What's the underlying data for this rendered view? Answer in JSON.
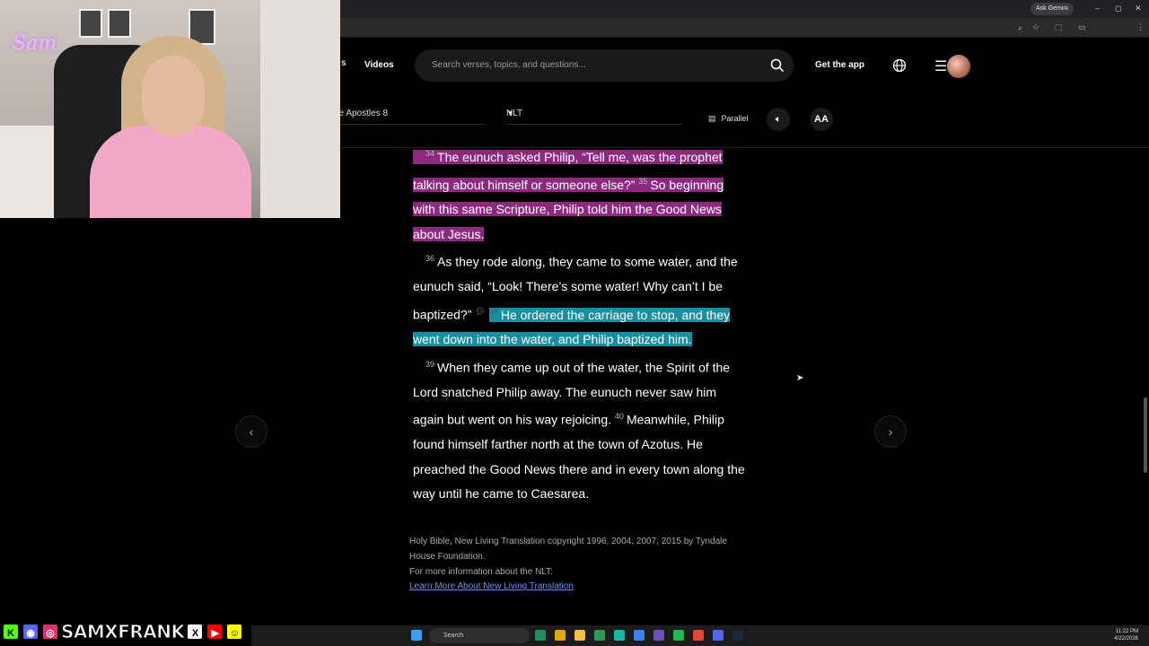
{
  "browser": {
    "gemini_label": "Ask Gemini",
    "window_controls": [
      "–",
      "◻",
      "✕"
    ]
  },
  "header": {
    "nav_partial": "s",
    "nav_videos": "Videos",
    "search_placeholder": "Search verses, topics, and questions...",
    "get_app": "Get the app",
    "book": "he Apostles 8",
    "version": "NLT",
    "parallel": "Parallel",
    "aa": "AA"
  },
  "passage": {
    "v34_num": "34",
    "v34_a": "The eunuch asked Philip, “Tell me, was the prophet talking about himself or someone else?”",
    "v35_num": "35",
    "v35": "So beginning with this same Scripture, Philip told him the Good News about Jesus.",
    "v36_num": "36",
    "v36": "As they rode along, they came to some water, and the eunuch said, “Look! There’s some water! Why can’t I be baptized?”",
    "v38_num": "38",
    "v38": "He ordered the carriage to stop, and they went down into the water, and Philip baptized him.",
    "v39_num": "39",
    "v39": "When they came up out of the water, the Spirit of the Lord snatched Philip away. The eunuch never saw him again but went on his way rejoicing.",
    "v40_num": "40",
    "v40": "Meanwhile, Philip found himself farther north at the town of Azotus. He preached the Good News there and in every town along the way until he came to Caesarea."
  },
  "footer": {
    "copyright": "Holy Bible, New Living Translation copyright 1996, 2004, 2007, 2015 by Tyndale House Foundation.",
    "more_info": "For more information about the NLT:",
    "link": "Learn More About New Living Translation"
  },
  "stream": {
    "brand": "SAMXFRANK",
    "cam_logo": "Sam"
  },
  "taskbar": {
    "search": "Search",
    "time": "11:22 PM",
    "date": "4/22/2026"
  },
  "colors": {
    "highlight_purple": "#8c2a80",
    "highlight_blue": "#1a8fa0",
    "link": "#6a8cff"
  }
}
